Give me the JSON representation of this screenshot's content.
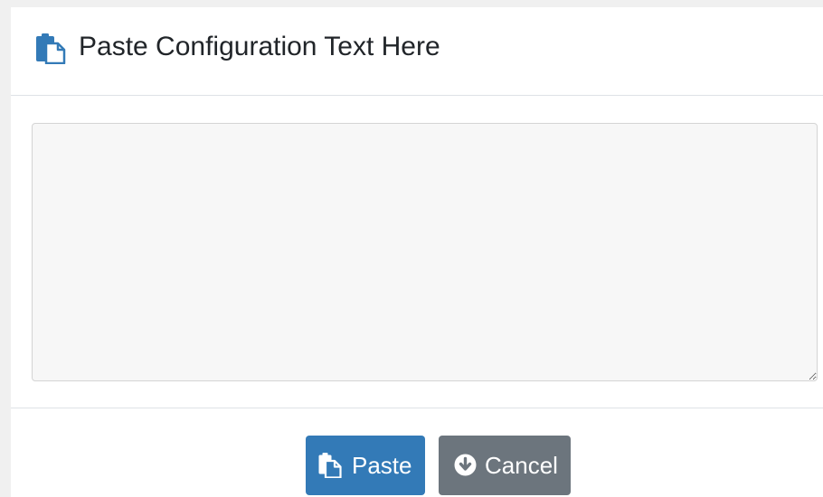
{
  "dialog": {
    "title": "Paste Configuration Text Here",
    "title_icon": "paste-icon"
  },
  "textarea": {
    "value": "",
    "placeholder": ""
  },
  "footer": {
    "paste_label": "Paste",
    "paste_icon": "paste-icon",
    "cancel_label": "Cancel",
    "cancel_icon": "circle-arrow-down-icon"
  },
  "colors": {
    "primary": "#337ab7",
    "secondary": "#6c757d",
    "textarea_bg": "#f7f7f7",
    "title_text": "#212529"
  }
}
